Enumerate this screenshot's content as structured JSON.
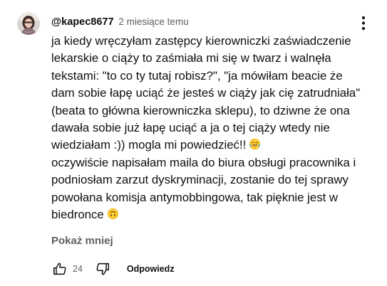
{
  "comment": {
    "author": "@kapec8677",
    "time": "2 miesiące temu",
    "lines": [
      "ja kiedy wręczyłam zastępcy kierowniczki zaświadczenie",
      "lekarskie o ciąży to zaśmiała mi się w twarz i walnęła",
      "tekstami: \"to co ty tutaj robisz?\", \"ja mówiłam beacie że",
      "dam sobie łapę uciąć że jesteś w ciąży jak cię zatrudniała\"",
      "(beata to główna kierowniczka sklepu), to dziwne że ona",
      "dawała sobie już łapę uciąć a ja o tej ciąży wtedy nie",
      "wiedziałam :)) mogla mi powiedzieć!!",
      "oczywiście napisałam maila do biura obsługi pracownika i",
      "podniosłam zarzut dyskryminacji, zostanie do tej sprawy",
      "powołana komisja antymobbingowa, tak pięknie jest w",
      "biedronce"
    ],
    "emojis": [
      "tears-of-joy-emoji",
      "upside-down-face-emoji"
    ],
    "show_less_label": "Pokaż mniej",
    "like_count": "24",
    "reply_label": "Odpowiedz"
  },
  "icons": {
    "menu": "more-vert-icon",
    "like": "thumb-up-outline-icon",
    "dislike": "thumb-down-outline-icon"
  },
  "colors": {
    "text": "#0f0f0f",
    "secondary": "#606060",
    "background": "#ffffff"
  }
}
